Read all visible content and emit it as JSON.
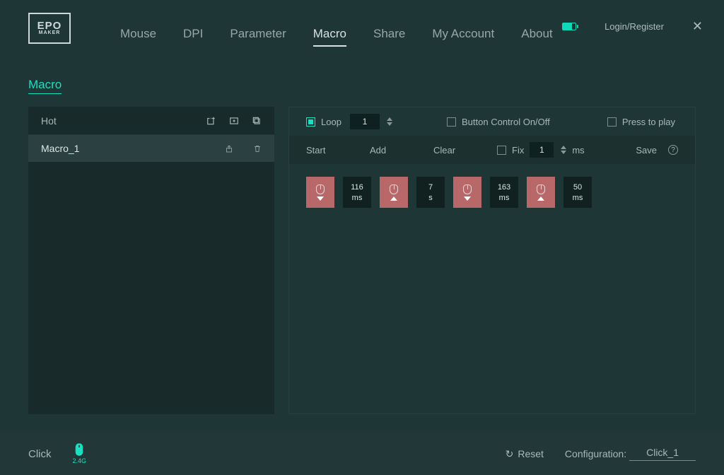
{
  "brand": {
    "line1": "EPO",
    "line2": "MAKER"
  },
  "nav": [
    "Mouse",
    "DPI",
    "Parameter",
    "Macro",
    "Share",
    "My Account",
    "About"
  ],
  "nav_active_index": 3,
  "header": {
    "login": "Login/Register"
  },
  "page_title": "Macro",
  "sidebar": {
    "title": "Hot",
    "items": [
      {
        "name": "Macro_1"
      }
    ]
  },
  "editor": {
    "loop": {
      "label": "Loop",
      "value": "1",
      "checked": true
    },
    "button_control": {
      "label": "Button Control On/Off",
      "checked": false
    },
    "press_to_play": {
      "label": "Press to play",
      "checked": false
    },
    "toolbar": {
      "start": "Start",
      "add": "Add",
      "clear": "Clear",
      "fix": {
        "label": "Fix",
        "value": "1",
        "unit": "ms",
        "checked": false
      },
      "save": "Save"
    },
    "sequence": [
      {
        "type": "key",
        "dir": "down"
      },
      {
        "type": "delay",
        "value": "116",
        "unit": "ms"
      },
      {
        "type": "key",
        "dir": "up"
      },
      {
        "type": "delay",
        "value": "7",
        "unit": "s"
      },
      {
        "type": "key",
        "dir": "down"
      },
      {
        "type": "delay",
        "value": "163",
        "unit": "ms"
      },
      {
        "type": "key",
        "dir": "up"
      },
      {
        "type": "delay",
        "value": "50",
        "unit": "ms"
      }
    ]
  },
  "footer": {
    "click": "Click",
    "mode": "2.4G",
    "reset": "Reset",
    "config_label": "Configuration:",
    "config_value": "Click_1"
  }
}
